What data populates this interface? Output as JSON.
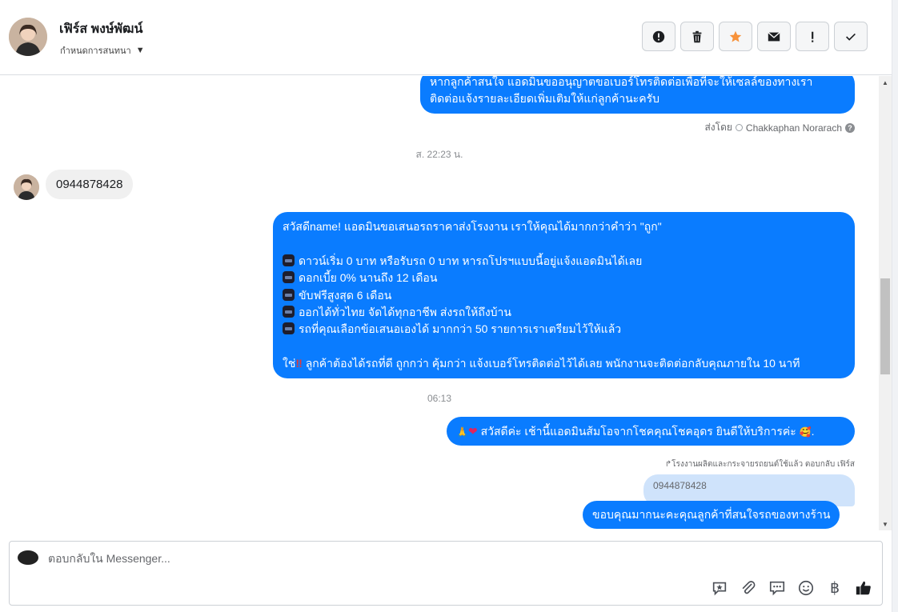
{
  "header": {
    "contact_name": "เฟิร์ส พงษ์พัฒน์",
    "assign_label": "กำหนดการสนทนา",
    "actions": [
      {
        "icon": "alert-circle-icon"
      },
      {
        "icon": "trash-icon"
      },
      {
        "icon": "star-icon",
        "color": "#f7923a"
      },
      {
        "icon": "mail-icon"
      },
      {
        "icon": "exclamation-icon"
      },
      {
        "icon": "check-icon"
      }
    ]
  },
  "thread": {
    "msg1": {
      "line1": "หากลูกค้าสนใจ แอดมินขออนุญาตขอเบอร์โทรติดต่อเพื่อที่จะให้เซลล์ของทางเรา",
      "line2": "ติดต่อแจ้งรายละเอียดเพิ่มเติมให้แก่ลูกค้านะครับ"
    },
    "sent_by_label": "ส่งโดย",
    "sent_by_name": "Chakkaphan Norarach",
    "time1": "ส. 22:23 น.",
    "incoming_phone": "0944878428",
    "msg2": {
      "greeting": "สวัสดีname! แอดมินขอเสนอรถราคาส่งโรงงาน เราให้คุณได้มากกว่าคำว่า \"ถูก\"",
      "bullets": [
        "ดาวน์เริ่ม 0 บาท หรือรับรถ 0 บาท หารถโปรฯแบบนี้อยู่แจ้งแอดมินได้เลย",
        "ดอกเบี้ย 0% นานถึง 12 เดือน",
        "ขับฟรีสูงสุด 6 เดือน",
        "ออกได้ทั่วไทย จัดได้ทุกอาชีพ ส่งรถให้ถึงบ้าน",
        "รถที่คุณเลือกข้อเสนอเองได้ มากกว่า 50 รายการเราเตรียมไว้ให้แล้ว"
      ],
      "closing_prefix": "ใช่",
      "closing": "ลูกค้าต้องได้รถที่ดี ถูกกว่า คุ้มกว่า แจ้งเบอร์โทรติดต่อไว้ได้เลย พนักงานจะติดต่อกลับคุณภายใน 10 นาที"
    },
    "time2": "06:13",
    "msg3": "สวัสดีค่ะ เช้านี้แอดมินส้มโอจากโชคคุณโชคอุดร ยินดีให้บริการค่ะ",
    "reply_meta": "↱โรงงานผลิตและกระจายรถยนต์ใช้แล้ว ตอบกลับ เฟิร์ส",
    "quoted_text": "0944878428",
    "msg4": "ขอบคุณมากนะคะคุณลูกค้าที่สนใจรถของทางร้าน"
  },
  "composer": {
    "placeholder": "ตอบกลับใน Messenger...",
    "tools": [
      "saved-reply-icon",
      "attachment-icon",
      "chat-bubbles-icon",
      "emoji-icon",
      "baht-icon",
      "thumbs-up-icon"
    ]
  }
}
